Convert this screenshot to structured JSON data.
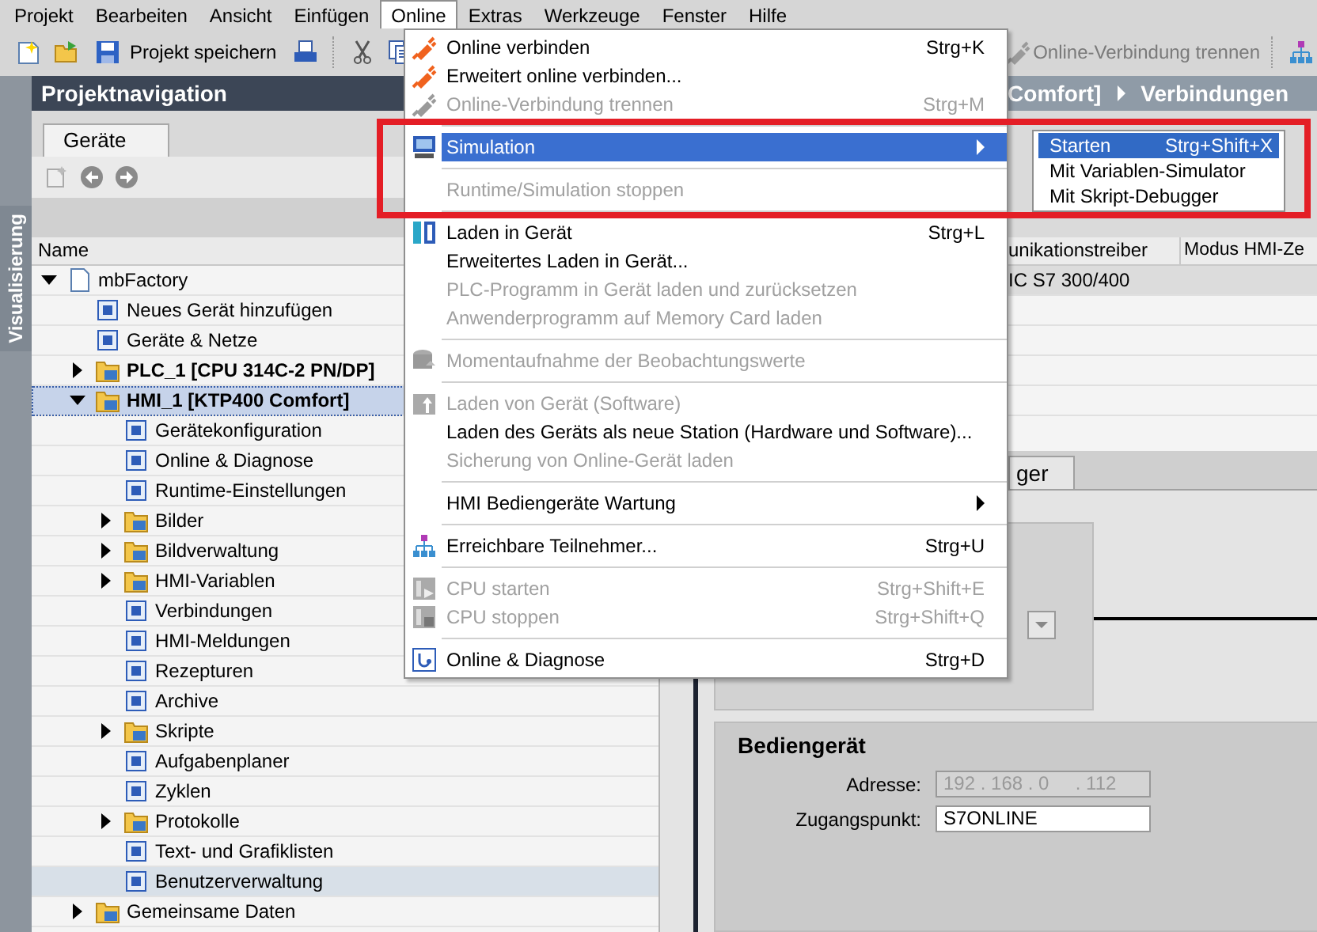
{
  "menubar": [
    {
      "label": "Projekt",
      "selected": false
    },
    {
      "label": "Bearbeiten",
      "selected": false
    },
    {
      "label": "Ansicht",
      "selected": false
    },
    {
      "label": "Einfügen",
      "selected": false
    },
    {
      "label": "Online",
      "selected": true
    },
    {
      "label": "Extras",
      "selected": false
    },
    {
      "label": "Werkzeuge",
      "selected": false
    },
    {
      "label": "Fenster",
      "selected": false
    },
    {
      "label": "Hilfe",
      "selected": false
    }
  ],
  "toolbar": {
    "save_label": "Projekt speichern",
    "disconnect": {
      "label": "Online-Verbindung trennen",
      "disabled": true
    }
  },
  "side_tab": {
    "label": "Visualisierung"
  },
  "project_navigation": {
    "title": "Projektnavigation",
    "tabs": [
      {
        "label": "Geräte",
        "selected": true
      }
    ],
    "column": "Name",
    "tree": [
      {
        "label": "mbFactory",
        "expanded": true,
        "selected": false,
        "hovered": false,
        "children": [
          {
            "label": "Neues Gerät hinzufügen",
            "selected": false,
            "hovered": false
          },
          {
            "label": "Geräte & Netze",
            "selected": false,
            "hovered": false
          },
          {
            "label": "PLC_1 [CPU 314C-2 PN/DP]",
            "bold": true,
            "expanded": false,
            "selected": false,
            "hovered": false
          },
          {
            "label": "HMI_1 [KTP400 Comfort]",
            "bold": true,
            "expanded": true,
            "selected": true,
            "hovered": false,
            "children": [
              {
                "label": "Gerätekonfiguration",
                "selected": false,
                "hovered": false
              },
              {
                "label": "Online & Diagnose",
                "selected": false,
                "hovered": false
              },
              {
                "label": "Runtime-Einstellungen",
                "selected": false,
                "hovered": false
              },
              {
                "label": "Bilder",
                "expanded": false,
                "selected": false,
                "hovered": false
              },
              {
                "label": "Bildverwaltung",
                "expanded": false,
                "selected": false,
                "hovered": false
              },
              {
                "label": "HMI-Variablen",
                "expanded": false,
                "selected": false,
                "hovered": false
              },
              {
                "label": "Verbindungen",
                "selected": false,
                "hovered": false
              },
              {
                "label": "HMI-Meldungen",
                "selected": false,
                "hovered": false
              },
              {
                "label": "Rezepturen",
                "selected": false,
                "hovered": false
              },
              {
                "label": "Archive",
                "selected": false,
                "hovered": false
              },
              {
                "label": "Skripte",
                "expanded": false,
                "selected": false,
                "hovered": false
              },
              {
                "label": "Aufgabenplaner",
                "selected": false,
                "hovered": false
              },
              {
                "label": "Zyklen",
                "selected": false,
                "hovered": false
              },
              {
                "label": "Protokolle",
                "expanded": false,
                "selected": false,
                "hovered": false
              },
              {
                "label": "Text- und Grafiklisten",
                "selected": false,
                "hovered": false
              },
              {
                "label": "Benutzerverwaltung",
                "selected": false,
                "hovered": true
              }
            ]
          },
          {
            "label": "Gemeinsame Daten",
            "expanded": false,
            "selected": false,
            "hovered": false
          }
        ]
      }
    ]
  },
  "editor": {
    "breadcrumb": [
      "Comfort]",
      "Verbindungen"
    ],
    "table": {
      "columns": [
        "unikationstreiber",
        "Modus HMI-Ze"
      ],
      "rows": [
        {
          "cells": [
            "IC S7 300/400"
          ]
        }
      ]
    },
    "tabs": [
      {
        "label": "ger",
        "selected": false
      }
    ],
    "operator_panel": {
      "title": "Bediengerät",
      "fields": [
        {
          "label": "Adresse:",
          "value": "192 . 168 . 0     . 112",
          "disabled": true
        },
        {
          "label": "Zugangspunkt:",
          "value": "S7ONLINE",
          "disabled": false
        }
      ]
    }
  },
  "menu": {
    "items": [
      {
        "kind": "item",
        "label": "Online verbinden",
        "shortcut": "Strg+K",
        "disabled": false,
        "selected": false
      },
      {
        "kind": "item",
        "label": "Erweitert online verbinden...",
        "disabled": false,
        "selected": false
      },
      {
        "kind": "item",
        "label": "Online-Verbindung trennen",
        "shortcut": "Strg+M",
        "disabled": true,
        "selected": false
      },
      {
        "kind": "separator"
      },
      {
        "kind": "item",
        "label": "Simulation",
        "submenu": true,
        "disabled": false,
        "selected": true
      },
      {
        "kind": "separator"
      },
      {
        "kind": "item",
        "label": "Runtime/Simulation stoppen",
        "disabled": true,
        "selected": false
      },
      {
        "kind": "separator"
      },
      {
        "kind": "item",
        "label": "Laden in Gerät",
        "shortcut": "Strg+L",
        "disabled": false,
        "selected": false
      },
      {
        "kind": "item",
        "label": "Erweitertes Laden in Gerät...",
        "disabled": false,
        "selected": false
      },
      {
        "kind": "item",
        "label": "PLC-Programm in Gerät laden und zurücksetzen",
        "disabled": true,
        "selected": false
      },
      {
        "kind": "item",
        "label": "Anwenderprogramm auf Memory Card laden",
        "disabled": true,
        "selected": false
      },
      {
        "kind": "separator"
      },
      {
        "kind": "item",
        "label": "Momentaufnahme der Beobachtungswerte",
        "disabled": true,
        "selected": false
      },
      {
        "kind": "separator"
      },
      {
        "kind": "item",
        "label": "Laden von Gerät (Software)",
        "disabled": true,
        "selected": false
      },
      {
        "kind": "item",
        "label": "Laden des Geräts als neue Station (Hardware und Software)...",
        "disabled": false,
        "selected": false
      },
      {
        "kind": "item",
        "label": "Sicherung von Online-Gerät laden",
        "disabled": true,
        "selected": false
      },
      {
        "kind": "separator"
      },
      {
        "kind": "item",
        "label": "HMI Bediengeräte Wartung",
        "submenu": true,
        "disabled": false,
        "selected": false
      },
      {
        "kind": "separator"
      },
      {
        "kind": "item",
        "label": "Erreichbare Teilnehmer...",
        "shortcut": "Strg+U",
        "disabled": false,
        "selected": false
      },
      {
        "kind": "separator"
      },
      {
        "kind": "item",
        "label": "CPU starten",
        "shortcut": "Strg+Shift+E",
        "disabled": true,
        "selected": false
      },
      {
        "kind": "item",
        "label": "CPU stoppen",
        "shortcut": "Strg+Shift+Q",
        "disabled": true,
        "selected": false
      },
      {
        "kind": "separator"
      },
      {
        "kind": "item",
        "label": "Online & Diagnose",
        "shortcut": "Strg+D",
        "disabled": false,
        "selected": false
      }
    ]
  },
  "submenu": {
    "items": [
      {
        "label": "Starten",
        "shortcut": "Strg+Shift+X",
        "selected": true
      },
      {
        "label": "Mit Variablen-Simulator",
        "selected": false
      },
      {
        "label": "Mit Skript-Debugger",
        "selected": false
      }
    ]
  },
  "annotation": {
    "kind": "frame"
  }
}
